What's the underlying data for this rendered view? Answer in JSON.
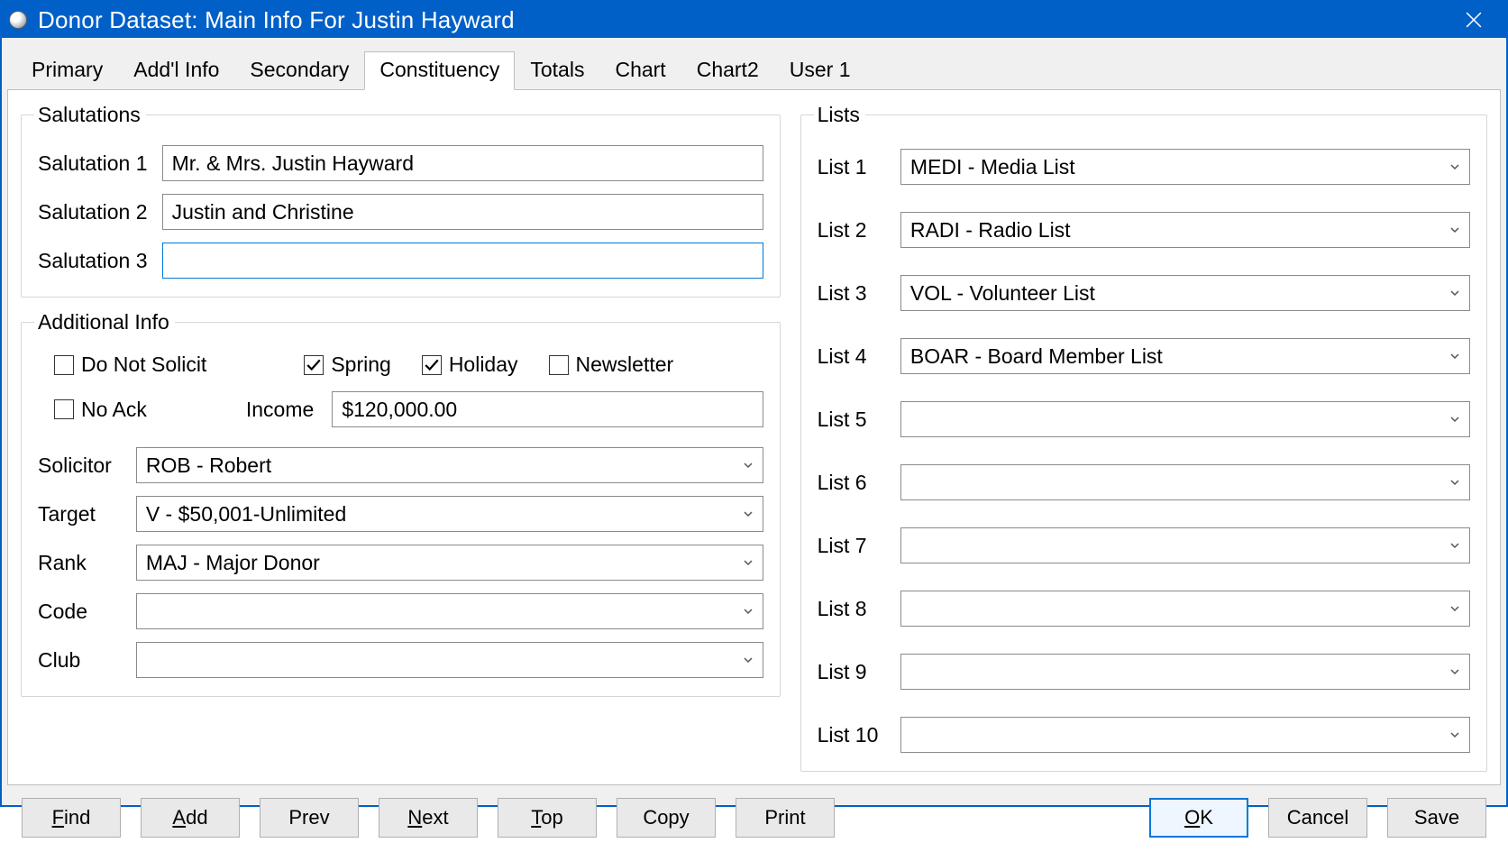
{
  "window": {
    "title": "Donor Dataset: Main Info For Justin Hayward"
  },
  "tabs": [
    {
      "label": "Primary",
      "active": false
    },
    {
      "label": "Add'l Info",
      "active": false
    },
    {
      "label": "Secondary",
      "active": false
    },
    {
      "label": "Constituency",
      "active": true
    },
    {
      "label": "Totals",
      "active": false
    },
    {
      "label": "Chart",
      "active": false
    },
    {
      "label": "Chart2",
      "active": false
    },
    {
      "label": "User 1",
      "active": false
    }
  ],
  "salutations": {
    "legend": "Salutations",
    "rows": [
      {
        "label": "Salutation 1",
        "value": "Mr. & Mrs. Justin Hayward"
      },
      {
        "label": "Salutation 2",
        "value": "Justin and Christine"
      },
      {
        "label": "Salutation 3",
        "value": ""
      }
    ]
  },
  "additional": {
    "legend": "Additional Info",
    "checks": {
      "do_not_solicit": {
        "label": "Do Not Solicit",
        "checked": false
      },
      "no_ack": {
        "label": "No Ack",
        "checked": false
      },
      "spring": {
        "label": "Spring",
        "checked": true
      },
      "holiday": {
        "label": "Holiday",
        "checked": true
      },
      "newsletter": {
        "label": "Newsletter",
        "checked": false
      }
    },
    "income": {
      "label": "Income",
      "value": "$120,000.00"
    },
    "selects": [
      {
        "label": "Solicitor",
        "value": "ROB - Robert"
      },
      {
        "label": "Target",
        "value": "V - $50,001-Unlimited"
      },
      {
        "label": "Rank",
        "value": "MAJ - Major Donor"
      },
      {
        "label": "Code",
        "value": ""
      },
      {
        "label": "Club",
        "value": ""
      }
    ]
  },
  "lists": {
    "legend": "Lists",
    "rows": [
      {
        "label": "List 1",
        "value": "MEDI - Media List"
      },
      {
        "label": "List 2",
        "value": "RADI - Radio List"
      },
      {
        "label": "List 3",
        "value": "VOL - Volunteer List"
      },
      {
        "label": "List 4",
        "value": "BOAR - Board Member List"
      },
      {
        "label": "List 5",
        "value": ""
      },
      {
        "label": "List 6",
        "value": ""
      },
      {
        "label": "List 7",
        "value": ""
      },
      {
        "label": "List 8",
        "value": ""
      },
      {
        "label": "List 9",
        "value": ""
      },
      {
        "label": "List 10",
        "value": ""
      }
    ]
  },
  "footer": {
    "find": "Find",
    "add": "Add",
    "prev": "Prev",
    "next": "Next",
    "top": "Top",
    "copy": "Copy",
    "print": "Print",
    "ok": "OK",
    "cancel": "Cancel",
    "save": "Save"
  }
}
